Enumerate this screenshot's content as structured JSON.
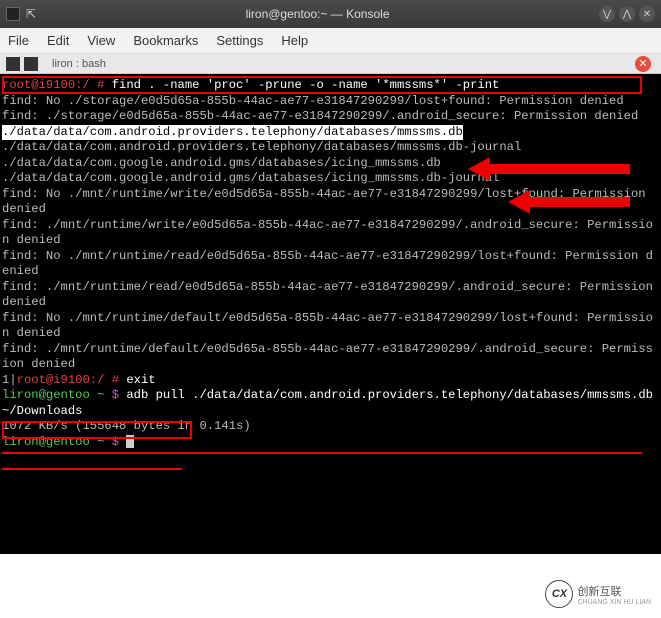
{
  "titlebar": {
    "title": "liron@gentoo:~ — Konsole"
  },
  "menubar": {
    "file": "File",
    "edit": "Edit",
    "view": "View",
    "bookmarks": "Bookmarks",
    "settings": "Settings",
    "help": "Help"
  },
  "tabbar": {
    "tab_label": "liron : bash"
  },
  "terminal": {
    "l1_prompt": "root@i9100:/ # ",
    "l1_cmd": "find . -name 'proc' -prune -o -name '*mmssms*' -print",
    "l2": "find: No ./storage/e0d5d65a-855b-44ac-ae77-e31847290299/lost+found: Permission denied",
    "l3": "find: ./storage/e0d5d65a-855b-44ac-ae77-e31847290299/.android_secure: Permission denied",
    "l4": "./data/data/com.android.providers.telephony/databases/mmssms.db",
    "l5": "./data/data/com.android.providers.telephony/databases/mmssms.db-journal",
    "l6": "./data/data/com.google.android.gms/databases/icing_mmssms.db",
    "l7": "./data/data/com.google.android.gms/databases/icing_mmssms.db-journal",
    "l8": "find: No ./mnt/runtime/write/e0d5d65a-855b-44ac-ae77-e31847290299/lost+found: Permission denied",
    "l9": "find: ./mnt/runtime/write/e0d5d65a-855b-44ac-ae77-e31847290299/.android_secure: Permission denied",
    "l10": "find: No ./mnt/runtime/read/e0d5d65a-855b-44ac-ae77-e31847290299/lost+found: Permission denied",
    "l11": "find: ./mnt/runtime/read/e0d5d65a-855b-44ac-ae77-e31847290299/.android_secure: Permission denied",
    "l12": "find: No ./mnt/runtime/default/e0d5d65a-855b-44ac-ae77-e31847290299/lost+found: Permission denied",
    "l13": "find: ./mnt/runtime/default/e0d5d65a-855b-44ac-ae77-e31847290299/.android_secure: Permission denied",
    "l14a": "1|",
    "l14_prompt": "root@i9100:/ # ",
    "l14_cmd": "exit",
    "l15_user": "liron@gentoo ",
    "l15_tilde": "~ ",
    "l15_dollar": "$ ",
    "l15_cmd": "adb pull ./data/data/com.android.providers.telephony/databases/mmssms.db ~/Downloads",
    "l16": "1072 KB/s (155648 bytes in 0.141s)",
    "l17_user": "liron@gentoo ",
    "l17_tilde": "~ ",
    "l17_dollar": "$ "
  },
  "footer": {
    "text": "创新互联",
    "sub": "CHUANG XIN HU LIAN"
  }
}
